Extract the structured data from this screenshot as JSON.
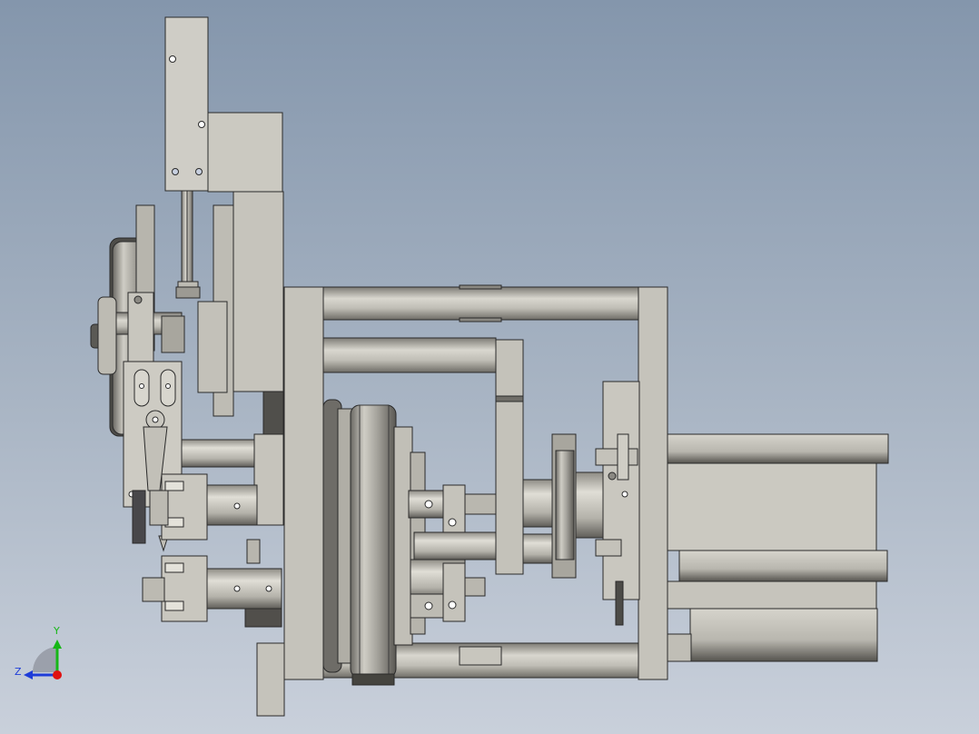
{
  "viewport": {
    "background_top": "#8496ac",
    "background_bottom": "#c9d0db"
  },
  "model": {
    "body_color": "#c9c7bf",
    "edge_color": "#2a2a2a",
    "shadow_color": "#5c5b57"
  },
  "triad": {
    "y_label": "Y",
    "z_label": "Z",
    "y_color": "#16b716",
    "z_color": "#1e3cd8",
    "origin_color": "#e01010"
  }
}
